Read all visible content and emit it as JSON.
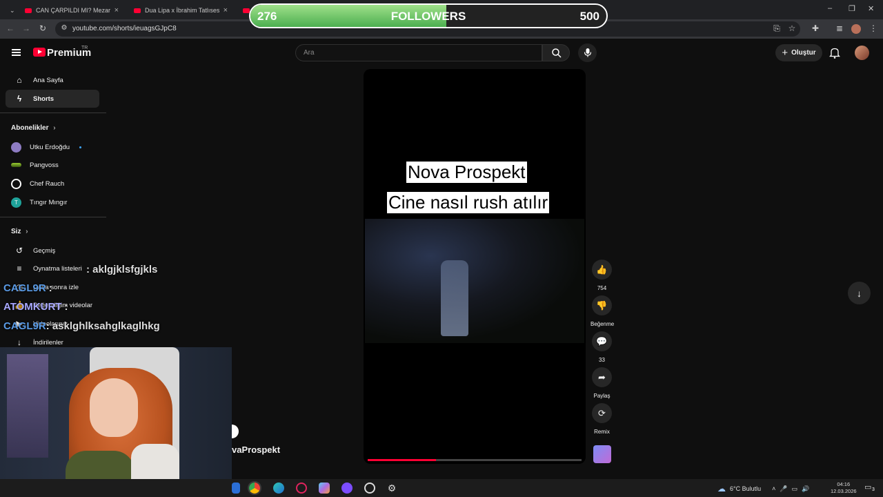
{
  "browser": {
    "tabs": [
      {
        "title": "CAN ÇARPILDI MI? Mezarlık Be"
      },
      {
        "title": "Dua Lipa x İbrahim Tatlıses - Du"
      }
    ],
    "url": "youtube.com/shorts/ieuagsGJpC8"
  },
  "overlay": {
    "followers_current": "276",
    "followers_label": "FOLLOWERS",
    "followers_goal": "500",
    "followers_progress": 0.55
  },
  "header": {
    "logo": "Premium",
    "region": "TR",
    "search_placeholder": "Ara",
    "create_label": "Oluştur"
  },
  "sidebar": {
    "main": [
      {
        "label": "Ana Sayfa",
        "icon": "home-icon"
      },
      {
        "label": "Shorts",
        "icon": "shorts-icon",
        "active": true
      }
    ],
    "subscriptions_title": "Abonelikler",
    "subscriptions": [
      {
        "label": "Utku Erdoğdu",
        "color": "#8e7cc3",
        "new": true
      },
      {
        "label": "Pangvoss",
        "color": "#9acd32"
      },
      {
        "label": "Chef Rauch",
        "color": "#ffffff"
      },
      {
        "label": "Tıngır Mıngır",
        "color": "#1fa39a",
        "initial": "T"
      }
    ],
    "you_title": "Siz",
    "you": [
      {
        "label": "Geçmiş",
        "icon": "history-icon"
      },
      {
        "label": "Oynatma listeleri",
        "icon": "playlist-icon"
      },
      {
        "label": "Daha sonra izle",
        "icon": "clock-icon"
      },
      {
        "label": "Beğendiğim videolar",
        "icon": "like-icon"
      },
      {
        "label": "Videolarınız",
        "icon": "video-icon"
      },
      {
        "label": "İndirilenler",
        "icon": "download-icon"
      }
    ]
  },
  "video": {
    "caption_1": "Nova Prospekt",
    "caption_2": "Cine nasıl rush atılır",
    "progress": 0.32,
    "channel": "vaProspekt"
  },
  "actions": {
    "likes": "754",
    "dislike_label": "Beğenme",
    "comments": "33",
    "share_label": "Paylaş",
    "remix_label": "Remix"
  },
  "chat": [
    {
      "user": "",
      "message": ": aklgjklsfgjkls"
    },
    {
      "user": "CAGL9R",
      "message": ":"
    },
    {
      "user": "ATOMKURT",
      "message": ":"
    },
    {
      "user": "CAGL9R",
      "message": ": asklghlksahglkaglhkg"
    }
  ],
  "taskbar": {
    "weather": "6°C Bulutlu",
    "time": "04:16",
    "date": "12.03.2026",
    "notifications": "3"
  }
}
